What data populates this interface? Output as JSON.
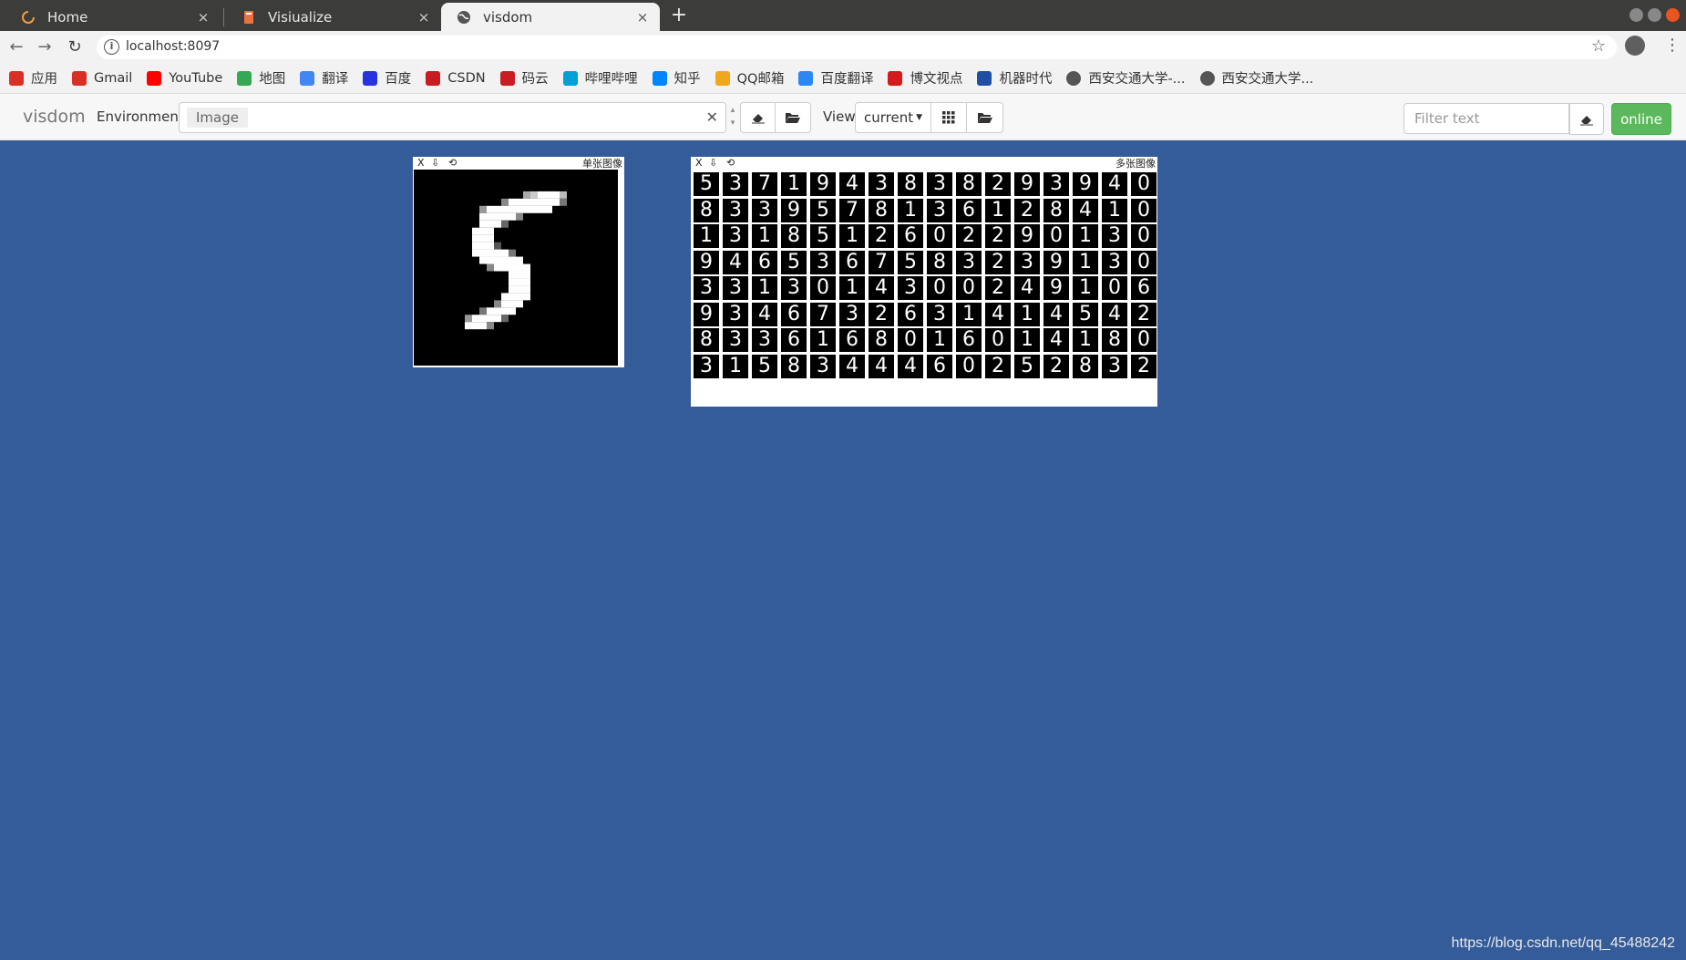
{
  "browser": {
    "tabs": [
      {
        "label": "Home",
        "icon": "loading-icon"
      },
      {
        "label": "Visiualize",
        "icon": "notebook-icon"
      },
      {
        "label": "visdom",
        "icon": "globe-icon",
        "active": true
      }
    ],
    "close_glyph": "×",
    "new_tab_glyph": "+",
    "url": "localhost:8097",
    "bookmarks": [
      {
        "label": "应用",
        "icon": "apps-grid-icon",
        "color": "#d93025"
      },
      {
        "label": "Gmail",
        "icon": "gmail-icon",
        "color": "#d93025"
      },
      {
        "label": "YouTube",
        "icon": "youtube-icon",
        "color": "#ff0000"
      },
      {
        "label": "地图",
        "icon": "maps-icon",
        "color": "#34a853"
      },
      {
        "label": "翻译",
        "icon": "translate-icon",
        "color": "#4285f4"
      },
      {
        "label": "百度",
        "icon": "baidu-icon",
        "color": "#2932e1"
      },
      {
        "label": "CSDN",
        "icon": "csdn-icon",
        "color": "#c91c21"
      },
      {
        "label": "码云",
        "icon": "gitee-icon",
        "color": "#c71d23"
      },
      {
        "label": "哔哩哔哩",
        "icon": "bilibili-icon",
        "color": "#00a1d6"
      },
      {
        "label": "知乎",
        "icon": "zhihu-icon",
        "color": "#0084ff"
      },
      {
        "label": "QQ邮箱",
        "icon": "qqmail-icon",
        "color": "#f0a81a"
      },
      {
        "label": "百度翻译",
        "icon": "baidu-translate-icon",
        "color": "#2b87f5"
      },
      {
        "label": "博文视点",
        "icon": "bowen-icon",
        "color": "#d6191a"
      },
      {
        "label": "机器时代",
        "icon": "jiqi-icon",
        "color": "#1f4fa3"
      },
      {
        "label": "西安交通大学-...",
        "icon": "globe-icon",
        "color": "#555555"
      },
      {
        "label": "西安交通大学...",
        "icon": "globe-icon",
        "color": "#555555"
      }
    ]
  },
  "visdom": {
    "brand": "visdom",
    "environment_label": "Environment",
    "environment_value": "Image",
    "view_label": "View",
    "view_value": "current",
    "filter_placeholder": "Filter text",
    "online_label": "online"
  },
  "panes": {
    "single": {
      "title": "单张图像",
      "controls": [
        "X",
        "⇩",
        "⟲"
      ]
    },
    "multi": {
      "title": "多张图像",
      "controls": [
        "X",
        "⇩",
        "⟲"
      ],
      "digits": [
        [
          "5",
          "3",
          "7",
          "1",
          "9",
          "4",
          "3",
          "8",
          "3",
          "8",
          "2",
          "9",
          "3",
          "9",
          "4",
          "0"
        ],
        [
          "8",
          "3",
          "3",
          "9",
          "5",
          "7",
          "8",
          "1",
          "3",
          "6",
          "1",
          "2",
          "8",
          "4",
          "1",
          "0"
        ],
        [
          "1",
          "3",
          "1",
          "8",
          "5",
          "1",
          "2",
          "6",
          "0",
          "2",
          "2",
          "9",
          "0",
          "1",
          "3",
          "0"
        ],
        [
          "9",
          "4",
          "6",
          "5",
          "3",
          "6",
          "7",
          "5",
          "8",
          "3",
          "2",
          "3",
          "9",
          "1",
          "3",
          "0"
        ],
        [
          "3",
          "3",
          "1",
          "3",
          "0",
          "1",
          "4",
          "3",
          "0",
          "0",
          "2",
          "4",
          "9",
          "1",
          "0",
          "6"
        ],
        [
          "9",
          "3",
          "4",
          "6",
          "7",
          "3",
          "2",
          "6",
          "3",
          "1",
          "4",
          "1",
          "4",
          "5",
          "4",
          "2"
        ],
        [
          "8",
          "3",
          "3",
          "6",
          "1",
          "6",
          "8",
          "0",
          "1",
          "6",
          "0",
          "1",
          "4",
          "1",
          "8",
          "0"
        ],
        [
          "3",
          "1",
          "5",
          "8",
          "3",
          "4",
          "4",
          "4",
          "6",
          "0",
          "2",
          "5",
          "2",
          "8",
          "3",
          "2"
        ]
      ]
    }
  },
  "watermark": "https://blog.csdn.net/qq_45488242"
}
